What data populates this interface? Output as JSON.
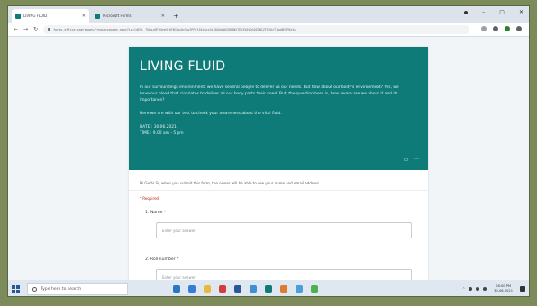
{
  "browser": {
    "tabs": [
      {
        "label": "LIVING FLUID",
        "active": true
      },
      {
        "label": "Microsoft Forms",
        "active": false
      }
    ],
    "new_tab_label": "+",
    "url": "forms.office.com/pages/responsepage.aspx?id=1dEtL_7UFqz0PJDeeH1HfN1Hw4efAwIPF8fJ0z8xx3iUOUOdN0IQRDNSTEQ3V0VOS0ZGN1ZFSUQzT1gwNE5FNi4u"
  },
  "form": {
    "title": "LIVING FLUID",
    "description": "In our surroundings environment, we have several people to deliver us our needs. But how about our body's environment? Yes, we have our blood that circulates to deliver all our body parts their need. But, the question here is, how aware are we about it and its importance?",
    "invite": "Here we are with our test to check your awareness about the vital fluid.",
    "date": "DATE : 30.06.2021",
    "time": "TIME : 9.00 am - 5 pm",
    "note": "Hi Gethi Sr, when you submit this form, the owner will be able to see your name and email address.",
    "required_label": "* Required",
    "questions": [
      {
        "label": "1. Name",
        "star": "*",
        "placeholder": "Enter your answer"
      },
      {
        "label": "2. Roll number",
        "star": "*",
        "placeholder": "Enter your answer"
      }
    ]
  },
  "taskbar": {
    "search_placeholder": "Type here to search",
    "clock_time": "08:00 PM",
    "clock_date": "30-06-2021"
  },
  "colors": {
    "banner": "#0f7b78",
    "required": "#b3261e"
  }
}
